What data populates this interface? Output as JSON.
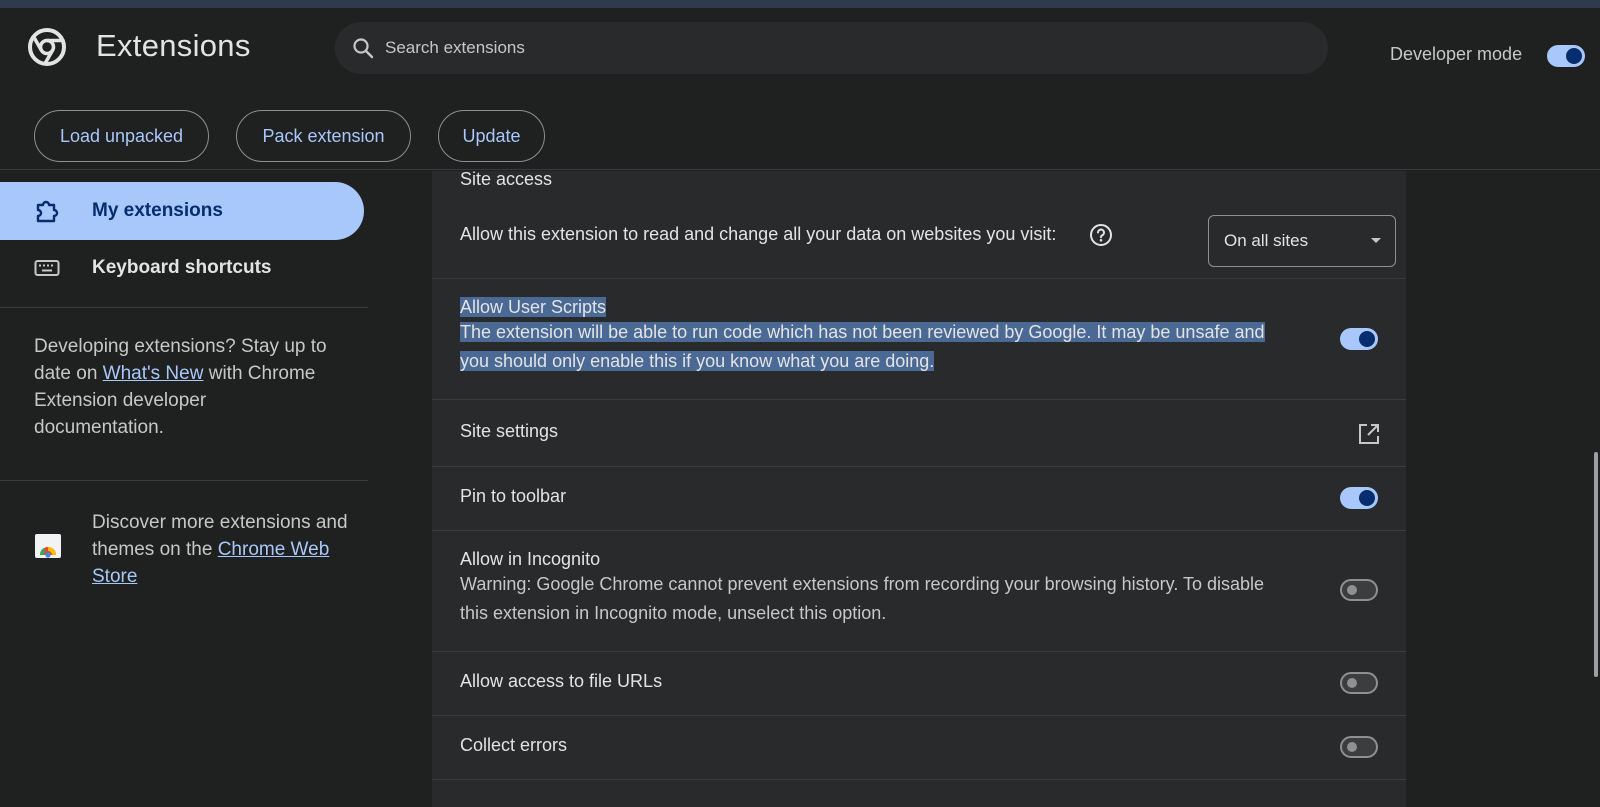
{
  "header": {
    "title": "Extensions",
    "search_placeholder": "Search extensions",
    "developer_mode_label": "Developer mode",
    "developer_mode_on": true,
    "buttons": {
      "load_unpacked": "Load unpacked",
      "pack_extension": "Pack extension",
      "update": "Update"
    }
  },
  "sidebar": {
    "items": [
      {
        "label": "My extensions",
        "icon": "extension-puzzle-icon",
        "active": true
      },
      {
        "label": "Keyboard shortcuts",
        "icon": "keyboard-icon",
        "active": false
      }
    ],
    "dev_text_before": "Developing extensions? Stay up to date on ",
    "dev_link": "What's New",
    "dev_text_after": " with Chrome Extension developer documentation.",
    "store_text_before": "Discover more extensions and themes on the ",
    "store_link": "Chrome Web Store"
  },
  "details": {
    "site_access": {
      "heading": "Site access",
      "label": "Allow this extension to read and change all your data on websites you visit:",
      "select_value": "On all sites"
    },
    "user_scripts": {
      "label": "Allow User Scripts",
      "desc_line1": "The extension will be able to run code which has not been reviewed by Google. It may be unsafe and",
      "desc_line2": "you should only enable this if you know what you are doing.",
      "enabled": true
    },
    "site_settings": {
      "label": "Site settings"
    },
    "pin_toolbar": {
      "label": "Pin to toolbar",
      "enabled": true
    },
    "incognito": {
      "label": "Allow in Incognito",
      "desc_line1": "Warning: Google Chrome cannot prevent extensions from recording your browsing history. To disable",
      "desc_line2": "this extension in Incognito mode, unselect this option.",
      "enabled": false
    },
    "file_urls": {
      "label": "Allow access to file URLs",
      "enabled": false
    },
    "collect_errors": {
      "label": "Collect errors",
      "enabled": false
    }
  },
  "colors": {
    "accent": "#a8c7fa",
    "background": "#1f2020",
    "card": "#282a2c",
    "selection": "#4a6a95"
  }
}
